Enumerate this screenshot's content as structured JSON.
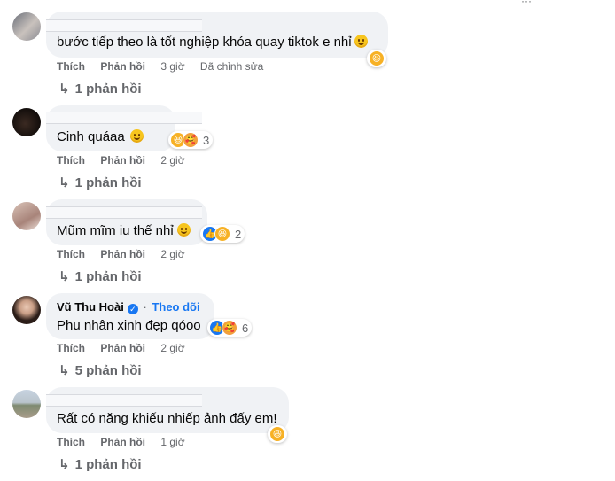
{
  "colors": {
    "bubble": "#f0f2f5",
    "meta": "#65676b",
    "link": "#1877f2"
  },
  "comments": [
    {
      "author": "",
      "text": "bước tiếp theo là tốt nghiệp khóa quay tiktok e nhỉ",
      "reactions": {
        "icons": [
          "haha-icon"
        ],
        "count": ""
      },
      "actions": {
        "like": "Thích",
        "reply": "Phản hồi",
        "time": "3 giờ",
        "edited": "Đã chỉnh sửa"
      },
      "replies": "1 phản hồi"
    },
    {
      "author": "",
      "text": "Cinh quáaa",
      "reactions": {
        "icons": [
          "haha-icon",
          "care-icon"
        ],
        "count": "3"
      },
      "actions": {
        "like": "Thích",
        "reply": "Phản hồi",
        "time": "2 giờ"
      },
      "replies": "1 phản hồi"
    },
    {
      "author": "",
      "text": "Mũm mĩm iu thế nhỉ",
      "reactions": {
        "icons": [
          "like-icon",
          "haha-icon"
        ],
        "count": "2"
      },
      "actions": {
        "like": "Thích",
        "reply": "Phản hồi",
        "time": "2 giờ"
      },
      "replies": "1 phản hồi"
    },
    {
      "author": "Vũ Thu Hoài",
      "follow": "Theo dõi",
      "text": "Phu nhân xinh đẹp qóoo",
      "reactions": {
        "icons": [
          "like-icon",
          "care-icon"
        ],
        "count": "6"
      },
      "actions": {
        "like": "Thích",
        "reply": "Phản hồi",
        "time": "2 giờ"
      },
      "replies": "5 phản hồi"
    },
    {
      "author": "",
      "text": "Rất có năng khiếu nhiếp ảnh đấy em!",
      "reactions": {
        "icons": [
          "haha-icon"
        ],
        "count": ""
      },
      "actions": {
        "like": "Thích",
        "reply": "Phản hồi",
        "time": "1 giờ"
      },
      "replies": "1 phản hồi"
    }
  ]
}
